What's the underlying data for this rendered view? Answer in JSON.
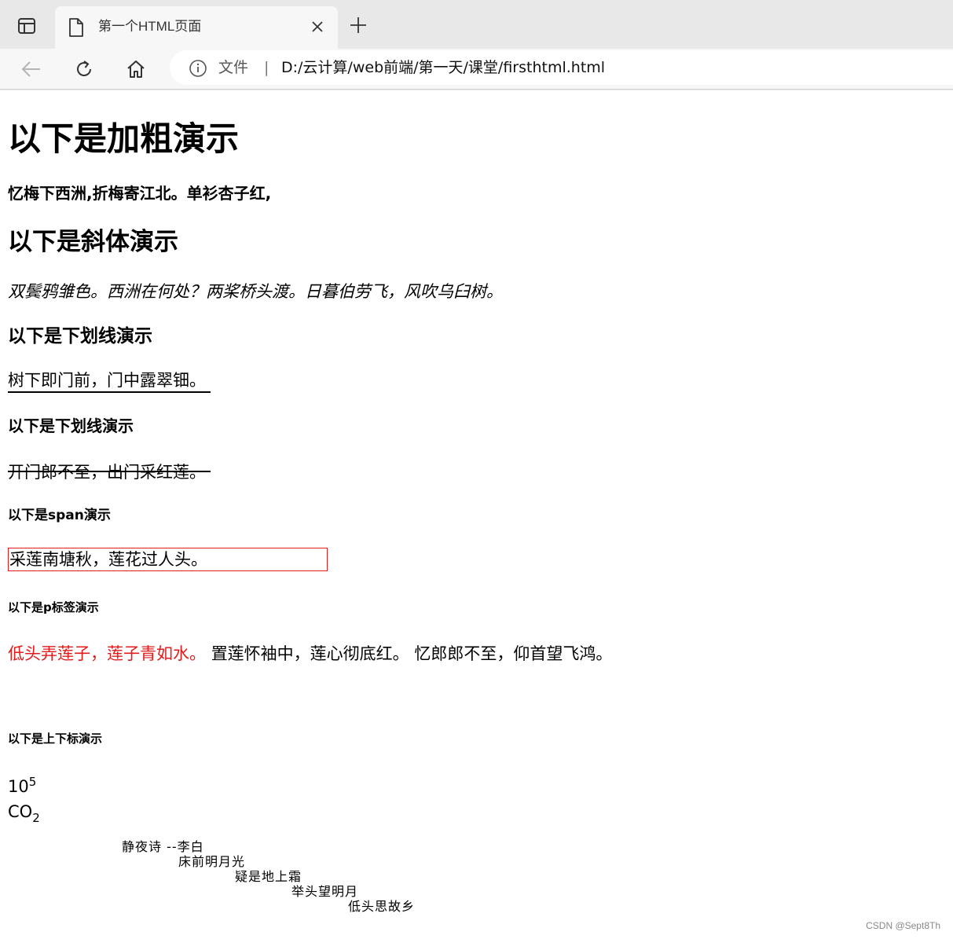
{
  "browser": {
    "tab": {
      "title": "第一个HTML页面"
    },
    "address_bar": {
      "file_label": "文件",
      "separator": "|",
      "url": "D:/云计算/web前端/第一天/课堂/firsthtml.html"
    }
  },
  "page": {
    "bold_heading": "以下是加粗演示",
    "bold_text": "忆梅下西洲,折梅寄江北。单衫杏子红,",
    "italic_heading": "以下是斜体演示",
    "italic_text": "双鬓鸦雏色。西洲在何处？两桨桥头渡。日暮伯劳飞，风吹乌臼树。",
    "underline_heading": "以下是下划线演示",
    "underline_text": "树下即门前，门中露翠钿。",
    "strike_heading": "以下是下划线演示",
    "strike_text": "开门郎不至，出门采红莲。",
    "span_heading": "以下是span演示",
    "span_text": "采莲南塘秋，莲花过人头。",
    "p_heading": "以下是p标签演示",
    "p_red_text": "低头弄莲子，莲子青如水。",
    "p_text_1": "置莲怀袖中，莲心彻底红。",
    "p_text_2": "忆郎郎不至，仰首望飞鸿。",
    "supsub_heading": "以下是上下标演示",
    "sup_base": "10",
    "sup_value": "5",
    "sub_base": "CO",
    "sub_value": "2",
    "poem": {
      "title_line": "静夜诗  --李白",
      "line1": "床前明月光",
      "line2": "疑是地上霜",
      "line3": "举头望明月",
      "line4": "低头思故乡"
    }
  },
  "watermark": "CSDN @Sept8Th",
  "colors": {
    "red": "#e31b1b",
    "chrome_bg": "#e8e8e8",
    "tab_bg": "#f7f7f7"
  },
  "icons": [
    "sidebar-icon",
    "document-icon",
    "close-icon",
    "plus-icon",
    "back-arrow-icon",
    "reload-icon",
    "home-icon",
    "info-icon"
  ]
}
